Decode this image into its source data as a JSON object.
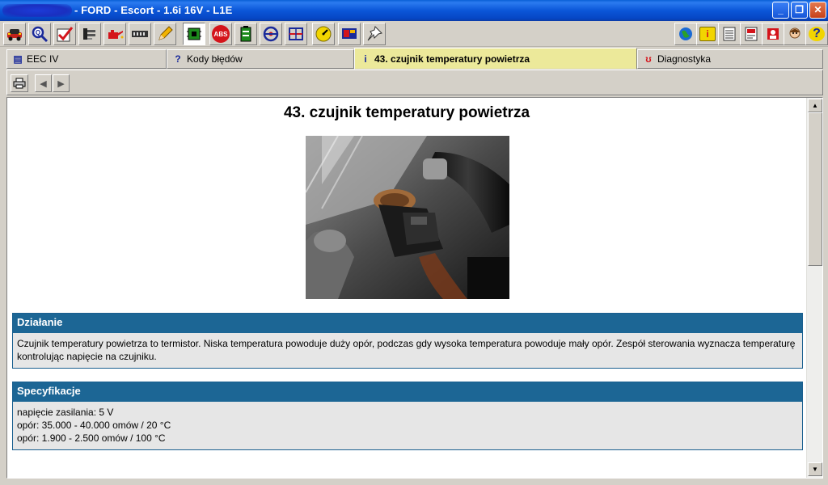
{
  "window": {
    "title": "- FORD - Escort - 1.6i 16V  - L1E",
    "controls": {
      "minimize": "_",
      "maximize": "❐",
      "close": "✕"
    }
  },
  "toolbar": {
    "left_icons": [
      "car-icon",
      "magnifier-icon",
      "checkmark-icon",
      "plug-icon",
      "oil-can-icon",
      "connector-icon",
      "pencil-icon",
      "chip-icon",
      "abs-icon",
      "battery-icon",
      "steering-icon",
      "schematic-icon",
      "gauge-icon",
      "display-icon",
      "pin-icon"
    ],
    "abs_label": "ABS",
    "right_icons": [
      "globe-icon",
      "info-icon",
      "notes-icon",
      "document-icon",
      "person-icon",
      "user-avatar-icon",
      "help-icon"
    ],
    "help_glyph": "?",
    "info_glyph": "i"
  },
  "tabs": [
    {
      "label": "EEC IV",
      "icon": "schematic-icon"
    },
    {
      "label": "Kody błędów",
      "icon": "question-icon"
    },
    {
      "label": "43. czujnik temperatury powietrza",
      "icon": "info-icon",
      "active": true
    },
    {
      "label": "Diagnostyka",
      "icon": "stethoscope-icon"
    }
  ],
  "subbar": {
    "print_icon": "printer-icon",
    "back_glyph": "◀",
    "forward_glyph": "▶"
  },
  "page": {
    "title": "43. czujnik temperatury powietrza",
    "sections": [
      {
        "heading": "Działanie",
        "lines": [
          "Czujnik temperatury powietrza to termistor. Niska temperatura powoduje duży opór, podczas gdy wysoka temperatura powoduje mały opór. Zespół sterowania wyznacza temperaturę kontrolując napięcie na czujniku."
        ]
      },
      {
        "heading": "Specyfikacje",
        "lines": [
          "napięcie zasilania: 5 V",
          "opór: 35.000 - 40.000 omów / 20 °C",
          "opór: 1.900 - 2.500 omów / 100 °C"
        ]
      }
    ]
  },
  "scrollbar": {
    "up_glyph": "▲",
    "down_glyph": "▼"
  },
  "colors": {
    "section_header": "#1c6695",
    "section_body": "#e6e6e6",
    "active_tab": "#ece99a",
    "titlebar": "#0b56d8"
  }
}
